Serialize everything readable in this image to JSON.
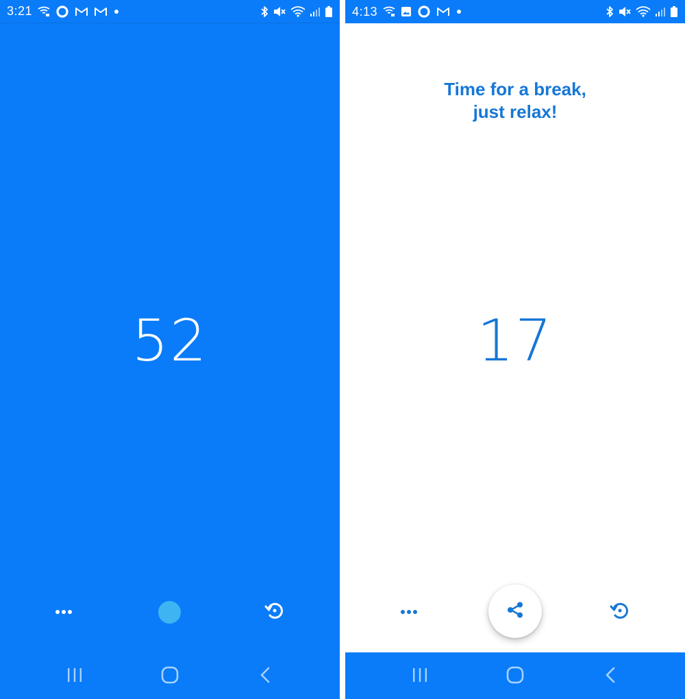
{
  "colors": {
    "primary_blue": "#0a7cf9",
    "accent_blue_text": "#1677d6",
    "light_dot": "#3fb4f3",
    "white": "#ffffff"
  },
  "left_phone": {
    "status_bar": {
      "time": "3:21",
      "icons_left": [
        "hotspot-icon",
        "sync-ring-icon",
        "gmail-icon",
        "gmail-icon",
        "notification-dot-icon"
      ],
      "icons_right": [
        "bluetooth-icon",
        "mute-icon",
        "wifi-icon",
        "signal-icon",
        "battery-icon"
      ]
    },
    "timer_value": "52",
    "controls": {
      "more": "more-horiz-icon",
      "center": "status-dot",
      "reset": "reset-timer-icon"
    }
  },
  "right_phone": {
    "status_bar": {
      "time": "4:13",
      "icons_left": [
        "hotspot-icon",
        "image-icon",
        "sync-ring-icon",
        "gmail-icon",
        "notification-dot-icon"
      ],
      "icons_right": [
        "bluetooth-icon",
        "mute-icon",
        "wifi-icon",
        "signal-icon",
        "battery-icon"
      ]
    },
    "break_message": {
      "line1": "Time for a break,",
      "line2": "just relax!"
    },
    "timer_value": "17",
    "controls": {
      "more": "more-horiz-icon",
      "share": "share-icon",
      "reset": "reset-timer-icon"
    }
  },
  "nav_bar": {
    "buttons": [
      "recents-icon",
      "home-icon",
      "back-icon"
    ]
  }
}
